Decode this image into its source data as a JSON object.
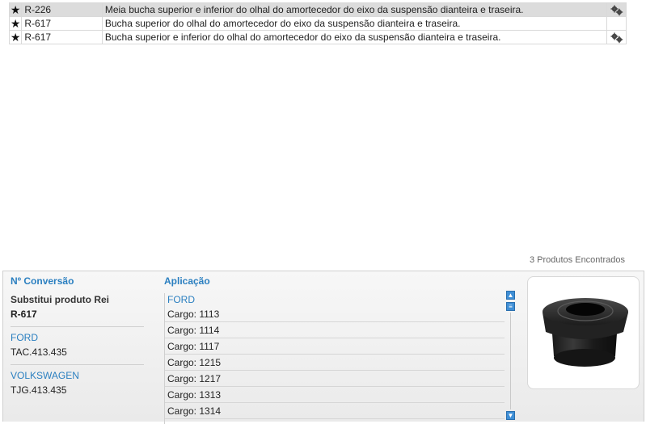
{
  "results": [
    {
      "code": "R-226",
      "description": "Meia bucha superior e inferior do olhal do amortecedor do eixo da suspensão dianteira e traseira.",
      "selected": true,
      "has_action": true
    },
    {
      "code": "R-617",
      "description": "Bucha superior do olhal do amortecedor do eixo da suspensão dianteira e traseira.",
      "selected": false,
      "has_action": false
    },
    {
      "code": "R-617",
      "description": "Bucha superior e inferior do olhal do amortecedor do eixo da suspensão dianteira e traseira.",
      "selected": false,
      "has_action": true
    }
  ],
  "count_text": "3 Produtos Encontrados",
  "conversion": {
    "header": "Nº Conversão",
    "substitutes_label": "Substitui produto Rei",
    "substitutes_code": "R-617",
    "items": [
      {
        "brand": "FORD",
        "code": "TAC.413.435"
      },
      {
        "brand": "VOLKSWAGEN",
        "code": "TJG.413.435"
      }
    ]
  },
  "application": {
    "header": "Aplicação",
    "brand": "FORD",
    "items": [
      "Cargo: 1113",
      "Cargo: 1114",
      "Cargo: 1117",
      "Cargo: 1215",
      "Cargo: 1217",
      "Cargo: 1313",
      "Cargo: 1314"
    ]
  },
  "icons": {
    "star": "star-icon",
    "action": "gears-icon",
    "scroll_up": "scroll-up-icon",
    "scroll_lines": "scroll-list-icon",
    "scroll_down": "scroll-down-icon"
  },
  "colors": {
    "accent": "#2a7fc0",
    "selected_row": "#dcdcdc",
    "scroll_button": "#3f8fd6"
  }
}
